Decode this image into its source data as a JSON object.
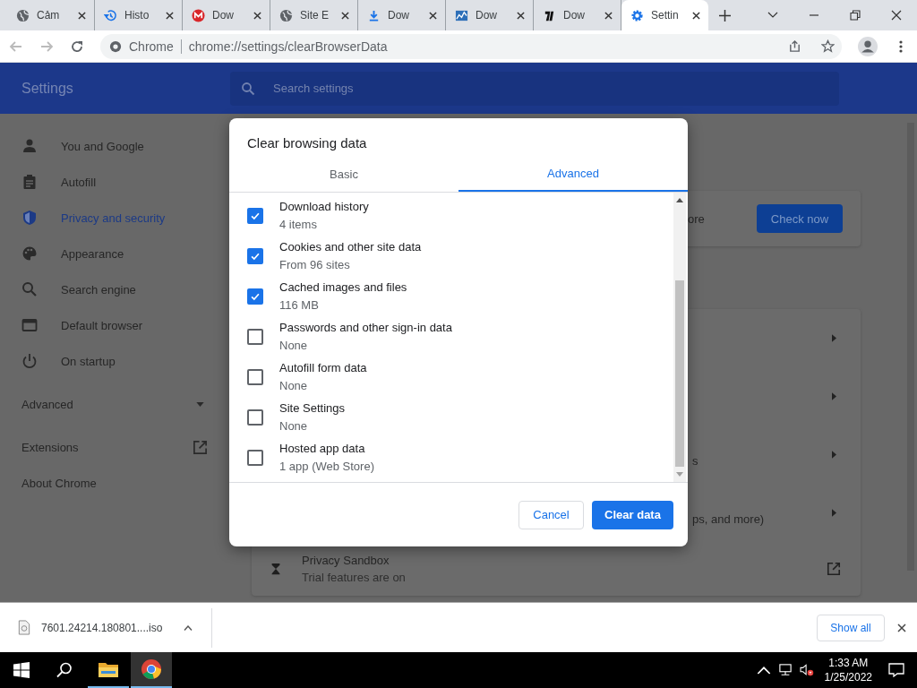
{
  "browser": {
    "tabs": [
      {
        "title": "Cảm",
        "kind": "globe",
        "selected": false
      },
      {
        "title": "Histo",
        "kind": "history",
        "selected": false
      },
      {
        "title": "Dow",
        "kind": "m",
        "selected": false
      },
      {
        "title": "Site E",
        "kind": "globe",
        "selected": false
      },
      {
        "title": "Dow",
        "kind": "download",
        "selected": false
      },
      {
        "title": "Dow",
        "kind": "chart",
        "selected": false
      },
      {
        "title": "Dow",
        "kind": "mark",
        "selected": false
      },
      {
        "title": "Settin",
        "kind": "gear",
        "selected": true
      }
    ],
    "site_label": "Chrome",
    "url": "chrome://settings/clearBrowserData"
  },
  "settings": {
    "title": "Settings",
    "search": {
      "placeholder": "Search settings"
    },
    "sidebar": {
      "items": [
        {
          "label": "You and Google",
          "kind": "person",
          "selected": false
        },
        {
          "label": "Autofill",
          "kind": "clipboard",
          "selected": false
        },
        {
          "label": "Privacy and security",
          "kind": "shield",
          "selected": true
        },
        {
          "label": "Appearance",
          "kind": "palette",
          "selected": false
        },
        {
          "label": "Search engine",
          "kind": "search",
          "selected": false
        },
        {
          "label": "Default browser",
          "kind": "browser",
          "selected": false
        },
        {
          "label": "On startup",
          "kind": "power",
          "selected": false
        }
      ],
      "advanced": {
        "label": "Advanced",
        "expanded": false
      },
      "links": [
        {
          "label": "Extensions",
          "kind": "external"
        },
        {
          "label": "About Chrome",
          "kind": "plain"
        }
      ]
    },
    "safety_card": {
      "text": "ore",
      "button": "Check now"
    },
    "rows": [
      {
        "kind": "plain"
      },
      {
        "kind": "plain"
      },
      {
        "kind": "text",
        "text": "s"
      },
      {
        "kind": "text",
        "text": "ps, and more)"
      }
    ],
    "sandbox": {
      "title": "Privacy Sandbox",
      "subtitle": "Trial features are on"
    }
  },
  "dialog": {
    "title": "Clear browsing data",
    "tabs": [
      {
        "label": "Basic",
        "selected": false
      },
      {
        "label": "Advanced",
        "selected": true
      }
    ],
    "items": [
      {
        "label": "Download history",
        "detail": "4 items",
        "checked": true
      },
      {
        "label": "Cookies and other site data",
        "detail": "From 96 sites",
        "checked": true
      },
      {
        "label": "Cached images and files",
        "detail": "116 MB",
        "checked": true
      },
      {
        "label": "Passwords and other sign-in data",
        "detail": "None",
        "checked": false
      },
      {
        "label": "Autofill form data",
        "detail": "None",
        "checked": false
      },
      {
        "label": "Site Settings",
        "detail": "None",
        "checked": false
      },
      {
        "label": "Hosted app data",
        "detail": "1 app (Web Store)",
        "checked": false
      }
    ],
    "cancel": "Cancel",
    "confirm": "Clear data"
  },
  "download_shelf": {
    "file": "7601.24214.180801....iso",
    "show_all": "Show all"
  },
  "taskbar": {
    "apps": [
      {
        "kind": "explorer",
        "active": false
      },
      {
        "kind": "chrome",
        "active": true
      }
    ],
    "time": "1:33 AM",
    "date": "1/25/2022"
  }
}
